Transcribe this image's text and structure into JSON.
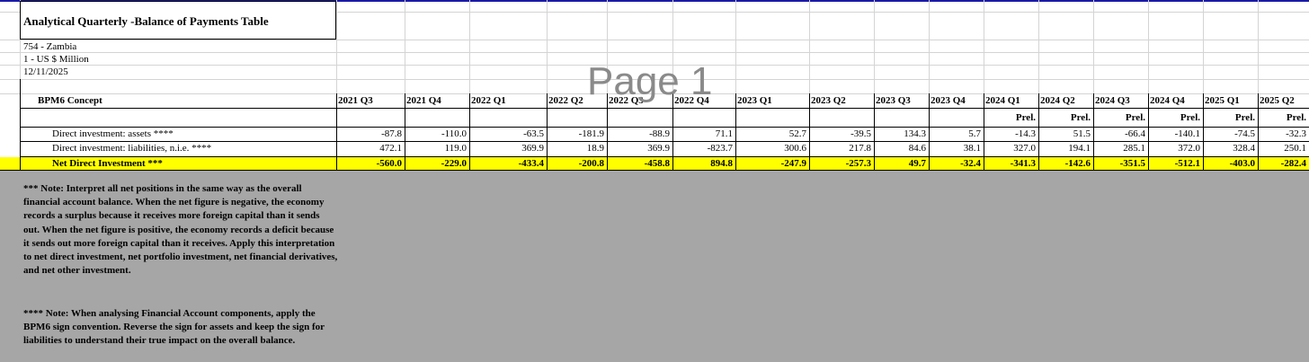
{
  "title": "Analytical Quarterly -Balance of Payments Table",
  "meta": {
    "country": "754 - Zambia",
    "units": "1 - US $ Million",
    "date": "12/11/2025"
  },
  "watermark": "Page 1",
  "concept_header": "BPM6 Concept",
  "periods": [
    "2021 Q3",
    "2021 Q4",
    "2022 Q1",
    "2022 Q2",
    "2022 Q3",
    "2022 Q4",
    "2023 Q1",
    "2023 Q2",
    "2023 Q3",
    "2023 Q4",
    "2024 Q1",
    "2024 Q2",
    "2024 Q3",
    "2024 Q4",
    "2025 Q1",
    "2025 Q2"
  ],
  "status": [
    "",
    "",
    "",
    "",
    "",
    "",
    "",
    "",
    "",
    "",
    "Prel.",
    "Prel.",
    "Prel.",
    "Prel.",
    "Prel.",
    "Prel."
  ],
  "rows": [
    {
      "label": "Direct investment: assets ****",
      "values": [
        "-87.8",
        "-110.0",
        "-63.5",
        "-181.9",
        "-88.9",
        "71.1",
        "52.7",
        "-39.5",
        "134.3",
        "5.7",
        "-14.3",
        "51.5",
        "-66.4",
        "-140.1",
        "-74.5",
        "-32.3"
      ]
    },
    {
      "label": "Direct investment: liabilities, n.i.e. ****",
      "values": [
        "472.1",
        "119.0",
        "369.9",
        "18.9",
        "369.9",
        "-823.7",
        "300.6",
        "217.8",
        "84.6",
        "38.1",
        "327.0",
        "194.1",
        "285.1",
        "372.0",
        "328.4",
        "250.1"
      ]
    },
    {
      "label": "Net Direct Investment ***",
      "values": [
        "-560.0",
        "-229.0",
        "-433.4",
        "-200.8",
        "-458.8",
        "894.8",
        "-247.9",
        "-257.3",
        "49.7",
        "-32.4",
        "-341.3",
        "-142.6",
        "-351.5",
        "-512.1",
        "-403.0",
        "-282.4"
      ]
    }
  ],
  "notes": [
    "*** Note: Interpret all net positions in the same way as the overall financial account balance. When the net figure is negative, the economy records a surplus because it receives more foreign capital than it sends out. When the net figure is positive, the economy records a deficit because it sends out more foreign capital than it receives. Apply this interpretation to net direct investment, net portfolio investment, net financial derivatives, and net other investment.",
    "**** Note: When analysing Financial Account components, apply the BPM6 sign convention. Reverse the sign for assets and keep the sign for liabilities to understand their true impact on the overall balance."
  ],
  "colors": {
    "highlight": "#ffff00",
    "note_bg": "#a6a6a6",
    "grid": "#d4d4d4"
  }
}
